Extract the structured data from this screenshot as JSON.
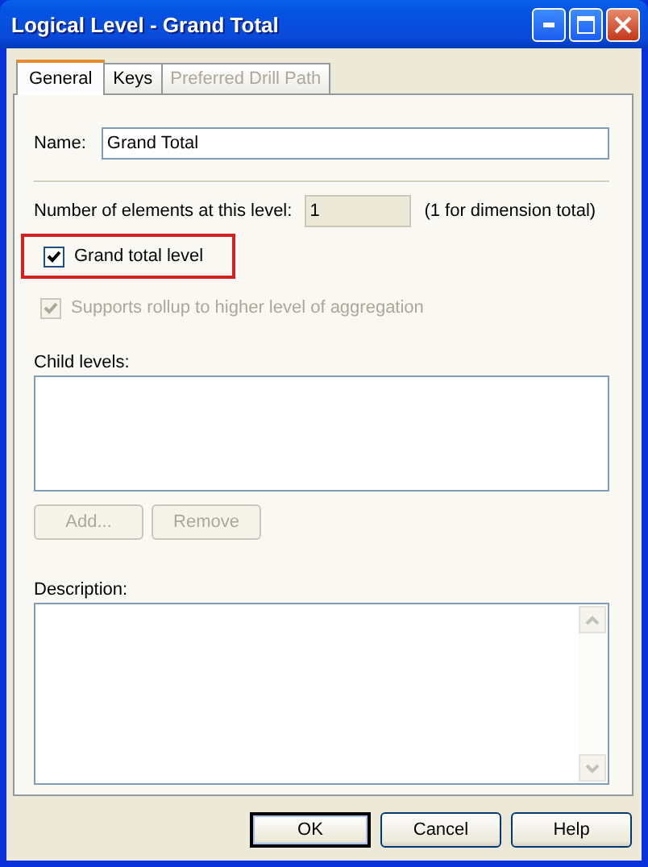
{
  "window": {
    "title": "Logical Level - Grand Total"
  },
  "tabs": [
    {
      "label": "General",
      "selected": true,
      "disabled": false
    },
    {
      "label": "Keys",
      "selected": false,
      "disabled": false
    },
    {
      "label": "Preferred Drill Path",
      "selected": false,
      "disabled": true
    }
  ],
  "name_field": {
    "label": "Name:",
    "value": "Grand Total"
  },
  "elements_field": {
    "label": "Number of elements at this level:",
    "value": "1",
    "disabled": true,
    "note": "(1 for dimension total)"
  },
  "checkboxes": [
    {
      "label": "Grand total level",
      "checked": true,
      "disabled": false,
      "highlighted": true
    },
    {
      "label": "Supports rollup to higher level of aggregation",
      "checked": true,
      "disabled": true,
      "highlighted": false
    }
  ],
  "child_levels": {
    "label": "Child levels:"
  },
  "child_buttons": [
    {
      "label": "Add...",
      "disabled": true
    },
    {
      "label": "Remove",
      "disabled": true
    }
  ],
  "description": {
    "label": "Description:"
  },
  "buttons": [
    {
      "label": "OK",
      "default": true
    },
    {
      "label": "Cancel",
      "default": false
    },
    {
      "label": "Help",
      "default": false
    }
  ]
}
